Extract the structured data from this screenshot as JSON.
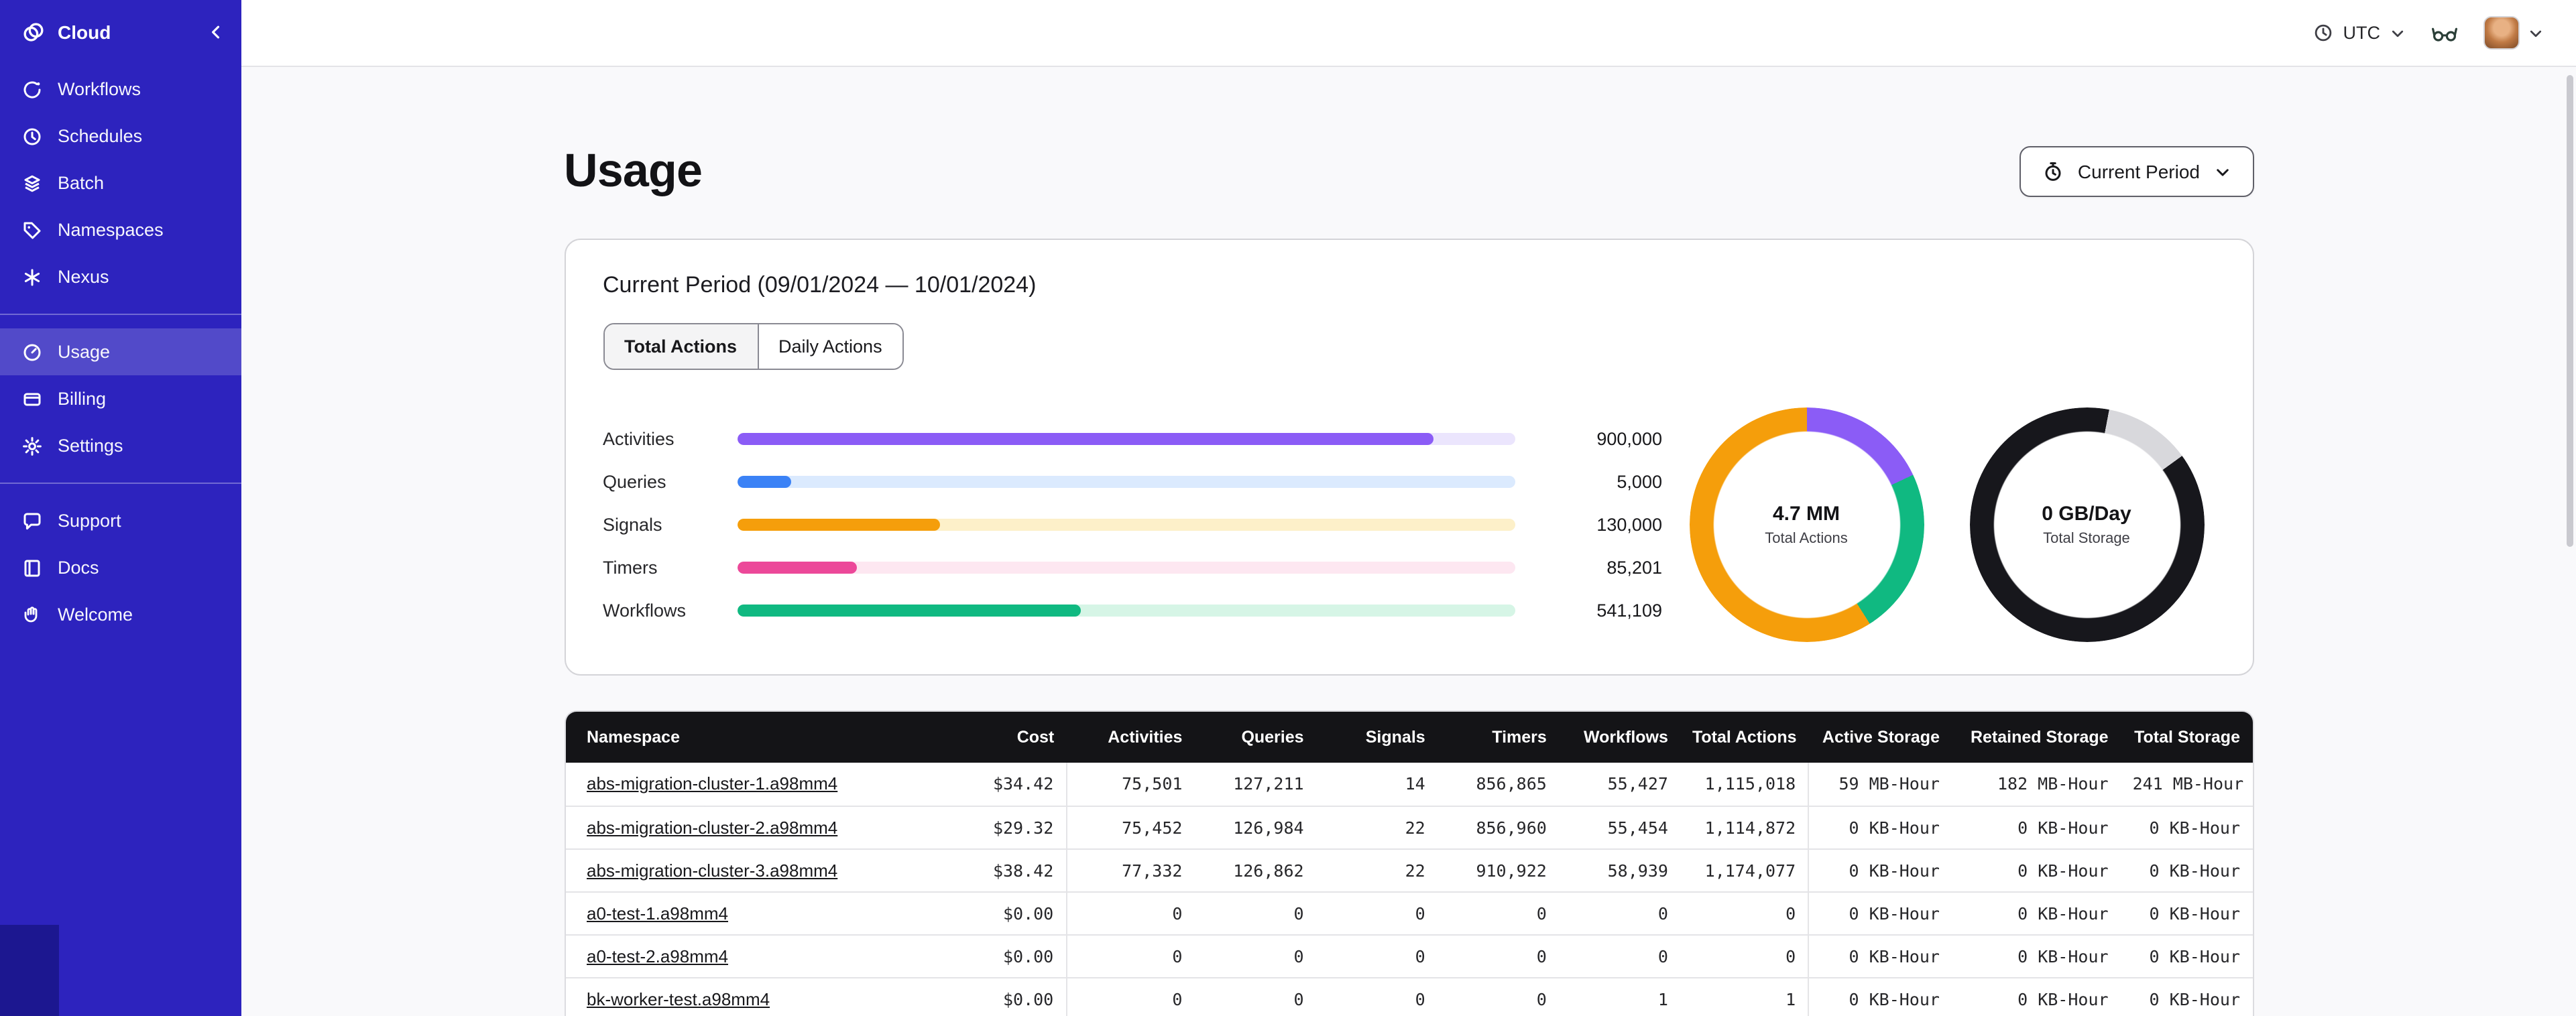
{
  "sidebar": {
    "header": {
      "label": "Cloud"
    },
    "groups": [
      {
        "items": [
          {
            "label": "Workflows"
          },
          {
            "label": "Schedules"
          },
          {
            "label": "Batch"
          },
          {
            "label": "Namespaces"
          },
          {
            "label": "Nexus"
          }
        ]
      },
      {
        "items": [
          {
            "label": "Usage",
            "active": true
          },
          {
            "label": "Billing"
          },
          {
            "label": "Settings"
          }
        ]
      },
      {
        "items": [
          {
            "label": "Support"
          },
          {
            "label": "Docs"
          },
          {
            "label": "Welcome"
          }
        ]
      }
    ]
  },
  "topbar": {
    "timezone": "UTC"
  },
  "page": {
    "title": "Usage",
    "period_selector": "Current Period"
  },
  "usage_card": {
    "title": "Current Period (09/01/2024 — 10/01/2024)",
    "tabs": [
      {
        "label": "Total Actions",
        "active": true
      },
      {
        "label": "Daily Actions",
        "active": false
      }
    ]
  },
  "chart_data": [
    {
      "type": "bar",
      "orientation": "horizontal",
      "title": "Current Period (09/01/2024 — 10/01/2024)",
      "categories": [
        "Activities",
        "Queries",
        "Signals",
        "Timers",
        "Workflows"
      ],
      "values": [
        900000,
        5000,
        130000,
        85201,
        541109
      ],
      "value_labels": [
        "900,000",
        "5,000",
        "130,000",
        "85,201",
        "541,109"
      ],
      "colors": [
        "#8b5cf6",
        "#3b82f6",
        "#f59e0b",
        "#ec4899",
        "#10b981"
      ],
      "track_colors": [
        "#ebe5fd",
        "#dbeafe",
        "#fdf0c9",
        "#fde7f1",
        "#d6f5e6"
      ],
      "fill_pct": [
        "89.6%",
        "7%",
        "26.2%",
        "15.5%",
        "44.2%"
      ]
    },
    {
      "type": "pie",
      "title": "Total Actions",
      "center_value": "4.7 MM",
      "segments": [
        {
          "color": "#8b5cf6",
          "pct": 18
        },
        {
          "color": "#10b981",
          "pct": 23
        },
        {
          "color": "#f59e0b",
          "pct": 59
        }
      ]
    },
    {
      "type": "pie",
      "title": "Total Storage",
      "center_value": "0 GB/Day",
      "segments": [
        {
          "color": "#17171c",
          "pct": 3
        },
        {
          "color": "#d8d8dc",
          "pct": 12
        },
        {
          "color": "#17171c",
          "pct": 85
        }
      ]
    }
  ],
  "table": {
    "columns": [
      "Namespace",
      "Cost",
      "Activities",
      "Queries",
      "Signals",
      "Timers",
      "Workflows",
      "Total Actions",
      "Active Storage",
      "Retained Storage",
      "Total Storage"
    ],
    "rows": [
      {
        "namespace": "abs-migration-cluster-1.a98mm4",
        "cost": "$34.42",
        "activities": "75,501",
        "queries": "127,211",
        "signals": "14",
        "timers": "856,865",
        "workflows": "55,427",
        "total_actions": "1,115,018",
        "active_storage": "59 MB-Hour",
        "retained_storage": "182 MB-Hour",
        "total_storage": "241 MB-Hour"
      },
      {
        "namespace": "abs-migration-cluster-2.a98mm4",
        "cost": "$29.32",
        "activities": "75,452",
        "queries": "126,984",
        "signals": "22",
        "timers": "856,960",
        "workflows": "55,454",
        "total_actions": "1,114,872",
        "active_storage": "0 KB-Hour",
        "retained_storage": "0 KB-Hour",
        "total_storage": "0 KB-Hour"
      },
      {
        "namespace": "abs-migration-cluster-3.a98mm4",
        "cost": "$38.42",
        "activities": "77,332",
        "queries": "126,862",
        "signals": "22",
        "timers": "910,922",
        "workflows": "58,939",
        "total_actions": "1,174,077",
        "active_storage": "0 KB-Hour",
        "retained_storage": "0 KB-Hour",
        "total_storage": "0 KB-Hour"
      },
      {
        "namespace": "a0-test-1.a98mm4",
        "cost": "$0.00",
        "activities": "0",
        "queries": "0",
        "signals": "0",
        "timers": "0",
        "workflows": "0",
        "total_actions": "0",
        "active_storage": "0 KB-Hour",
        "retained_storage": "0 KB-Hour",
        "total_storage": "0 KB-Hour"
      },
      {
        "namespace": "a0-test-2.a98mm4",
        "cost": "$0.00",
        "activities": "0",
        "queries": "0",
        "signals": "0",
        "timers": "0",
        "workflows": "0",
        "total_actions": "0",
        "active_storage": "0 KB-Hour",
        "retained_storage": "0 KB-Hour",
        "total_storage": "0 KB-Hour"
      },
      {
        "namespace": "bk-worker-test.a98mm4",
        "cost": "$0.00",
        "activities": "0",
        "queries": "0",
        "signals": "0",
        "timers": "0",
        "workflows": "1",
        "total_actions": "1",
        "active_storage": "0 KB-Hour",
        "retained_storage": "0 KB-Hour",
        "total_storage": "0 KB-Hour"
      }
    ]
  }
}
